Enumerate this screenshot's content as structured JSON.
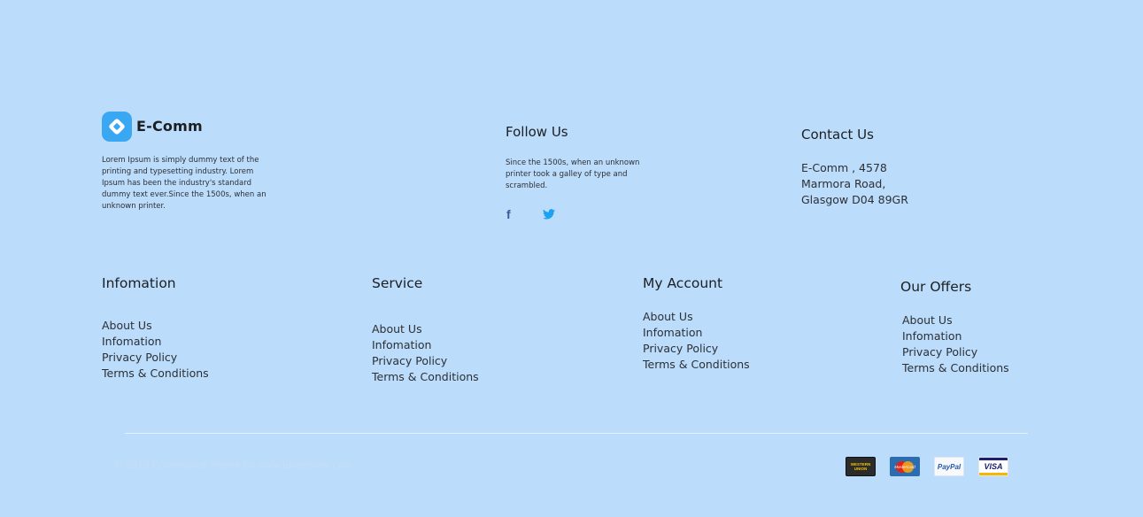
{
  "brand": {
    "name": "E-Comm",
    "description": "Lorem Ipsum is simply dummy text of the printing and typesetting industry. Lorem Ipsum has been the industry's standard dummy text ever.Since the 1500s, when an unknown printer."
  },
  "follow": {
    "title": "Follow Us",
    "text": "Since the 1500s, when an unknown printer took a galley of type and scrambled.",
    "icons": [
      "facebook-icon",
      "twitter-icon"
    ]
  },
  "contact": {
    "title": "Contact Us",
    "lines": [
      "E-Comm , 4578",
      "Marmora Road,",
      "Glasgow D04 89GR"
    ]
  },
  "columns": [
    {
      "title": "Infomation",
      "links": [
        "About Us",
        "Infomation",
        "Privacy Policy",
        "Terms & Conditions"
      ]
    },
    {
      "title": "Service",
      "links": [
        "About Us",
        "Infomation",
        "Privacy Policy",
        "Terms & Conditions"
      ]
    },
    {
      "title": "My Account",
      "links": [
        "About Us",
        "Infomation",
        "Privacy Policy",
        "Terms & Conditions"
      ]
    },
    {
      "title": "Our Offers",
      "links": [
        "About Us",
        "Infomation",
        "Privacy Policy",
        "Terms & Conditions"
      ]
    }
  ],
  "copyright": "© 2018 Ecommerce theme by www.bisenbaev.com",
  "payments": {
    "western_union": "WESTERN UNION",
    "mastercard": "MasterCard",
    "paypal": "PayPal",
    "visa": "VISA"
  },
  "colors": {
    "background": "#bcdcfb",
    "accent": "#3aa7f2",
    "facebook": "#3b5998",
    "twitter": "#1da1f2"
  }
}
